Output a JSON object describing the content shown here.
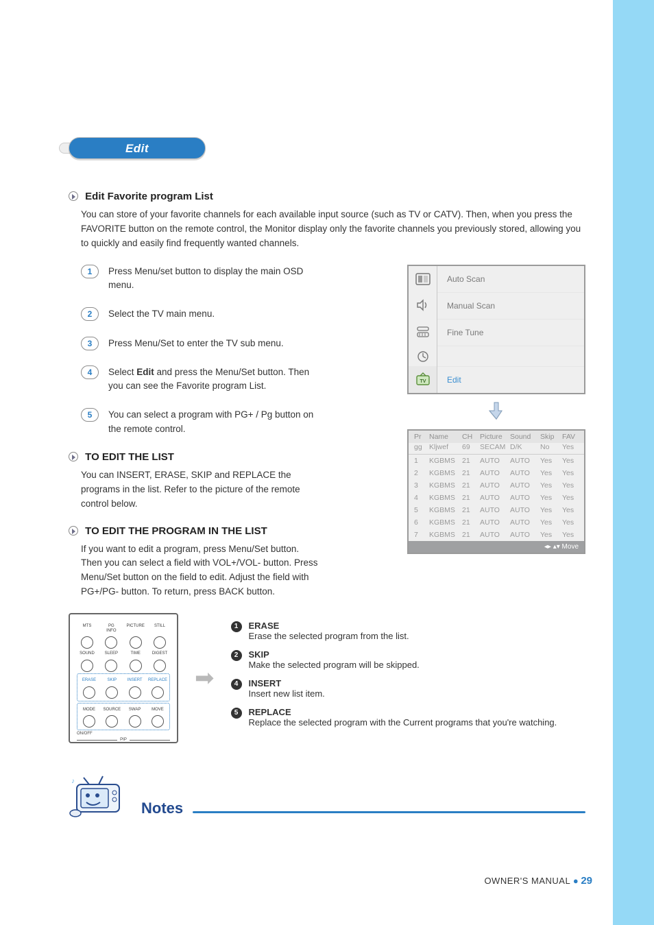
{
  "heading": "Edit",
  "intro": {
    "title": "Edit Favorite program List",
    "body": "You can store of your favorite channels for each available input source (such as TV or CATV). Then, when you press the FAVORITE button on the remote control, the Monitor display only the favorite channels you previously stored, allowing you to quickly and easily find frequently wanted channels."
  },
  "steps": [
    {
      "n": "1",
      "text": "Press Menu/set button to display the main OSD menu."
    },
    {
      "n": "2",
      "text": "Select the TV main menu."
    },
    {
      "n": "3",
      "text": "Press Menu/Set to enter the TV sub menu."
    },
    {
      "n": "4",
      "text_pre": "Select ",
      "bold": "Edit",
      "text_post": " and press the Menu/Set button. Then you can see the Favorite program List."
    },
    {
      "n": "5",
      "text": "You can select a program with PG+ / Pg button on the remote control."
    }
  ],
  "section_edit_list": {
    "title": "TO EDIT THE LIST",
    "body": "You can INSERT, ERASE, SKIP and REPLACE the programs in the list. Refer to the picture of the remote control below."
  },
  "section_edit_prog": {
    "title": "TO EDIT THE PROGRAM IN THE LIST",
    "body": "If you want to edit a program, press Menu/Set button. Then you can select a field with VOL+/VOL- button. Press Menu/Set button on the field to edit. Adjust the field with PG+/PG- button. To return, press BACK button."
  },
  "osd_menu": {
    "items": [
      {
        "label": "Auto Scan",
        "active": false
      },
      {
        "label": "Manual Scan",
        "active": false
      },
      {
        "label": "Fine Tune",
        "active": false
      },
      {
        "label": "Edit",
        "active": true
      }
    ],
    "icons": [
      "picture",
      "sound",
      "feature",
      "timer",
      "tv"
    ]
  },
  "program_table": {
    "headers": [
      "Pr",
      "Name",
      "CH",
      "Picture",
      "Sound",
      "Skip",
      "FAV"
    ],
    "subheads": [
      "gg",
      "Kljwef",
      "69",
      "SECAM",
      "D/K",
      "No",
      "Yes"
    ],
    "rows": [
      [
        "1",
        "KGBMS",
        "21",
        "AUTO",
        "AUTO",
        "Yes",
        "Yes"
      ],
      [
        "2",
        "KGBMS",
        "21",
        "AUTO",
        "AUTO",
        "Yes",
        "Yes"
      ],
      [
        "3",
        "KGBMS",
        "21",
        "AUTO",
        "AUTO",
        "Yes",
        "Yes"
      ],
      [
        "4",
        "KGBMS",
        "21",
        "AUTO",
        "AUTO",
        "Yes",
        "Yes"
      ],
      [
        "5",
        "KGBMS",
        "21",
        "AUTO",
        "AUTO",
        "Yes",
        "Yes"
      ],
      [
        "6",
        "KGBMS",
        "21",
        "AUTO",
        "AUTO",
        "Yes",
        "Yes"
      ],
      [
        "7",
        "KGBMS",
        "21",
        "AUTO",
        "AUTO",
        "Yes",
        "Yes"
      ]
    ],
    "foot_prefix": "◂▸ ▴▾ ",
    "foot": "Move"
  },
  "remote": {
    "rows": [
      {
        "labels": [
          "MTS",
          "PG\nINFO",
          "PICTURE",
          "STILL"
        ]
      },
      {
        "labels": [
          "SOUND",
          "SLEEP",
          "TIME",
          "DIGEST"
        ]
      }
    ],
    "box1": [
      "ERASE",
      "SKIP",
      "INSERT",
      "REPLACE"
    ],
    "box2": [
      "MODE",
      "SOURCE",
      "SWAP",
      "MOVE"
    ],
    "pip": "PIP",
    "onoff": "ON/OFF"
  },
  "actions": [
    {
      "num": "1",
      "title": "ERASE",
      "desc": "Erase the selected program from the list."
    },
    {
      "num": "2",
      "title": "SKIP",
      "desc": "Make the selected program will be skipped."
    },
    {
      "num": "4",
      "title": "INSERT",
      "desc": "Insert new list item."
    },
    {
      "num": "5",
      "title": "REPLACE",
      "desc": "Replace the selected program with the Current programs that you're watching."
    }
  ],
  "notes_label": "Notes",
  "footer": {
    "owner": "OWNER'S MANUAL",
    "page": "29"
  }
}
